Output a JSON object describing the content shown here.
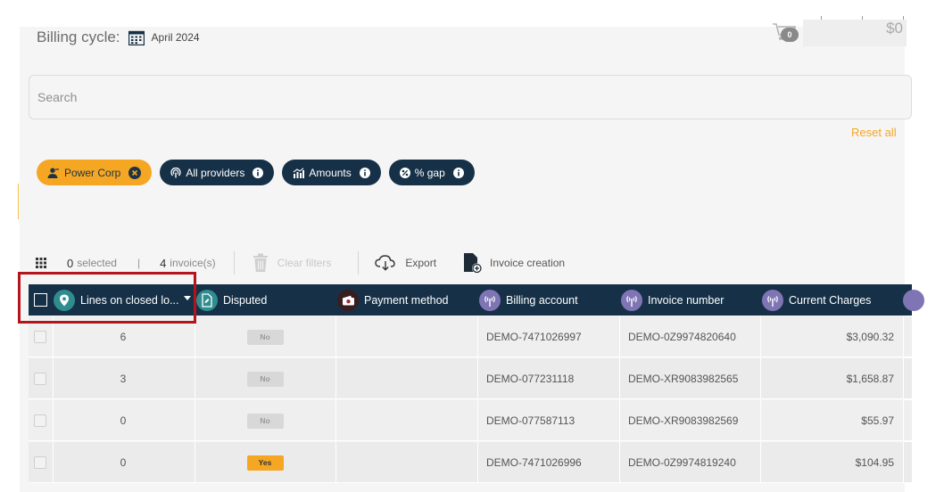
{
  "header": {
    "billing_label": "Billing cycle:",
    "billing_value": "April 2024",
    "cart_count": "0",
    "amount": "$0"
  },
  "search": {
    "placeholder": "Search"
  },
  "reset_label": "Reset all",
  "chips": [
    {
      "label": "Power Corp",
      "style": "active",
      "icon": "user-icon",
      "trail": "close-icon"
    },
    {
      "label": "All providers",
      "style": "dark",
      "icon": "antenna-icon",
      "trail": "info-icon"
    },
    {
      "label": "Amounts",
      "style": "dark",
      "icon": "chart-icon",
      "trail": "info-icon"
    },
    {
      "label": "% gap",
      "style": "dark",
      "icon": "percent-icon",
      "trail": "info-icon"
    }
  ],
  "toolbar": {
    "selected_count": "0",
    "selected_label": "selected",
    "invoice_count": "4",
    "invoice_label": "invoice(s)",
    "clear_label": "Clear filters",
    "export_label": "Export",
    "invoice_creation_label": "Invoice creation"
  },
  "table": {
    "columns": [
      {
        "label": "Lines on closed lo...",
        "icon": "location-pin-icon",
        "icon_color": "#2f8d8f"
      },
      {
        "label": "Disputed",
        "icon": "document-icon",
        "icon_color": "#2f8d8f"
      },
      {
        "label": "Payment method",
        "icon": "wallet-icon",
        "icon_color": "#a02a32"
      },
      {
        "label": "Billing account",
        "icon": "antenna-icon",
        "icon_color": "#7f75b5"
      },
      {
        "label": "Invoice number",
        "icon": "antenna-icon",
        "icon_color": "#7f75b5"
      },
      {
        "label": "Current Charges",
        "icon": "antenna-icon",
        "icon_color": "#7f75b5"
      }
    ],
    "rows": [
      {
        "lines": "6",
        "disputed": "No",
        "payment": "",
        "account": "DEMO-7471026997",
        "invoice": "DEMO-0Z9974820640",
        "charges": "$3,090.32"
      },
      {
        "lines": "3",
        "disputed": "No",
        "payment": "",
        "account": "DEMO-077231118",
        "invoice": "DEMO-XR9083982565",
        "charges": "$1,658.87"
      },
      {
        "lines": "0",
        "disputed": "No",
        "payment": "",
        "account": "DEMO-077587113",
        "invoice": "DEMO-XR9083982569",
        "charges": "$55.97"
      },
      {
        "lines": "0",
        "disputed": "Yes",
        "payment": "",
        "account": "DEMO-7471026996",
        "invoice": "DEMO-0Z9974819240",
        "charges": "$104.95"
      }
    ]
  },
  "colors": {
    "accent": "#f5a623",
    "header_bg": "#163147",
    "highlight_border": "#b4141b"
  }
}
